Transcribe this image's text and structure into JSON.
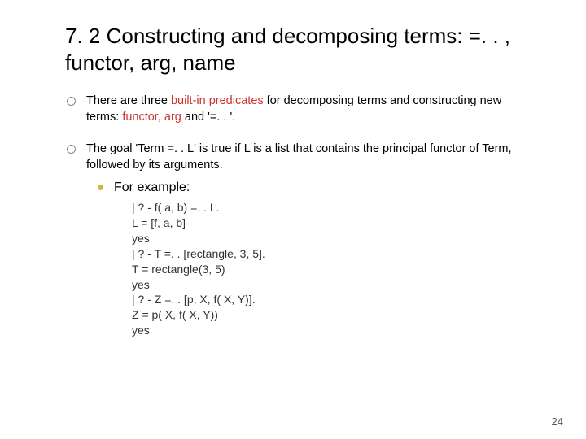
{
  "title": "7. 2 Constructing and decomposing terms: =. . , functor, arg, name",
  "bullet1": {
    "pre": "There are three ",
    "red": "built-in predicates",
    "post1": " for decomposing terms and constructing new terms: ",
    "terms": "functor, arg",
    "post2": " and '=. . '."
  },
  "bullet2": "The goal 'Term =. . L' is true if L is a list that contains the principal functor of Term, followed by its arguments.",
  "sub_label": "For example:",
  "code_lines": [
    "| ? - f( a, b) =. . L.",
    "L = [f, a, b]",
    "yes",
    "| ? - T =. . [rectangle, 3, 5].",
    "T = rectangle(3, 5)",
    "yes",
    "| ? - Z =. . [p, X, f( X, Y)].",
    "Z = p( X, f( X, Y))",
    "yes"
  ],
  "page_number": "24"
}
